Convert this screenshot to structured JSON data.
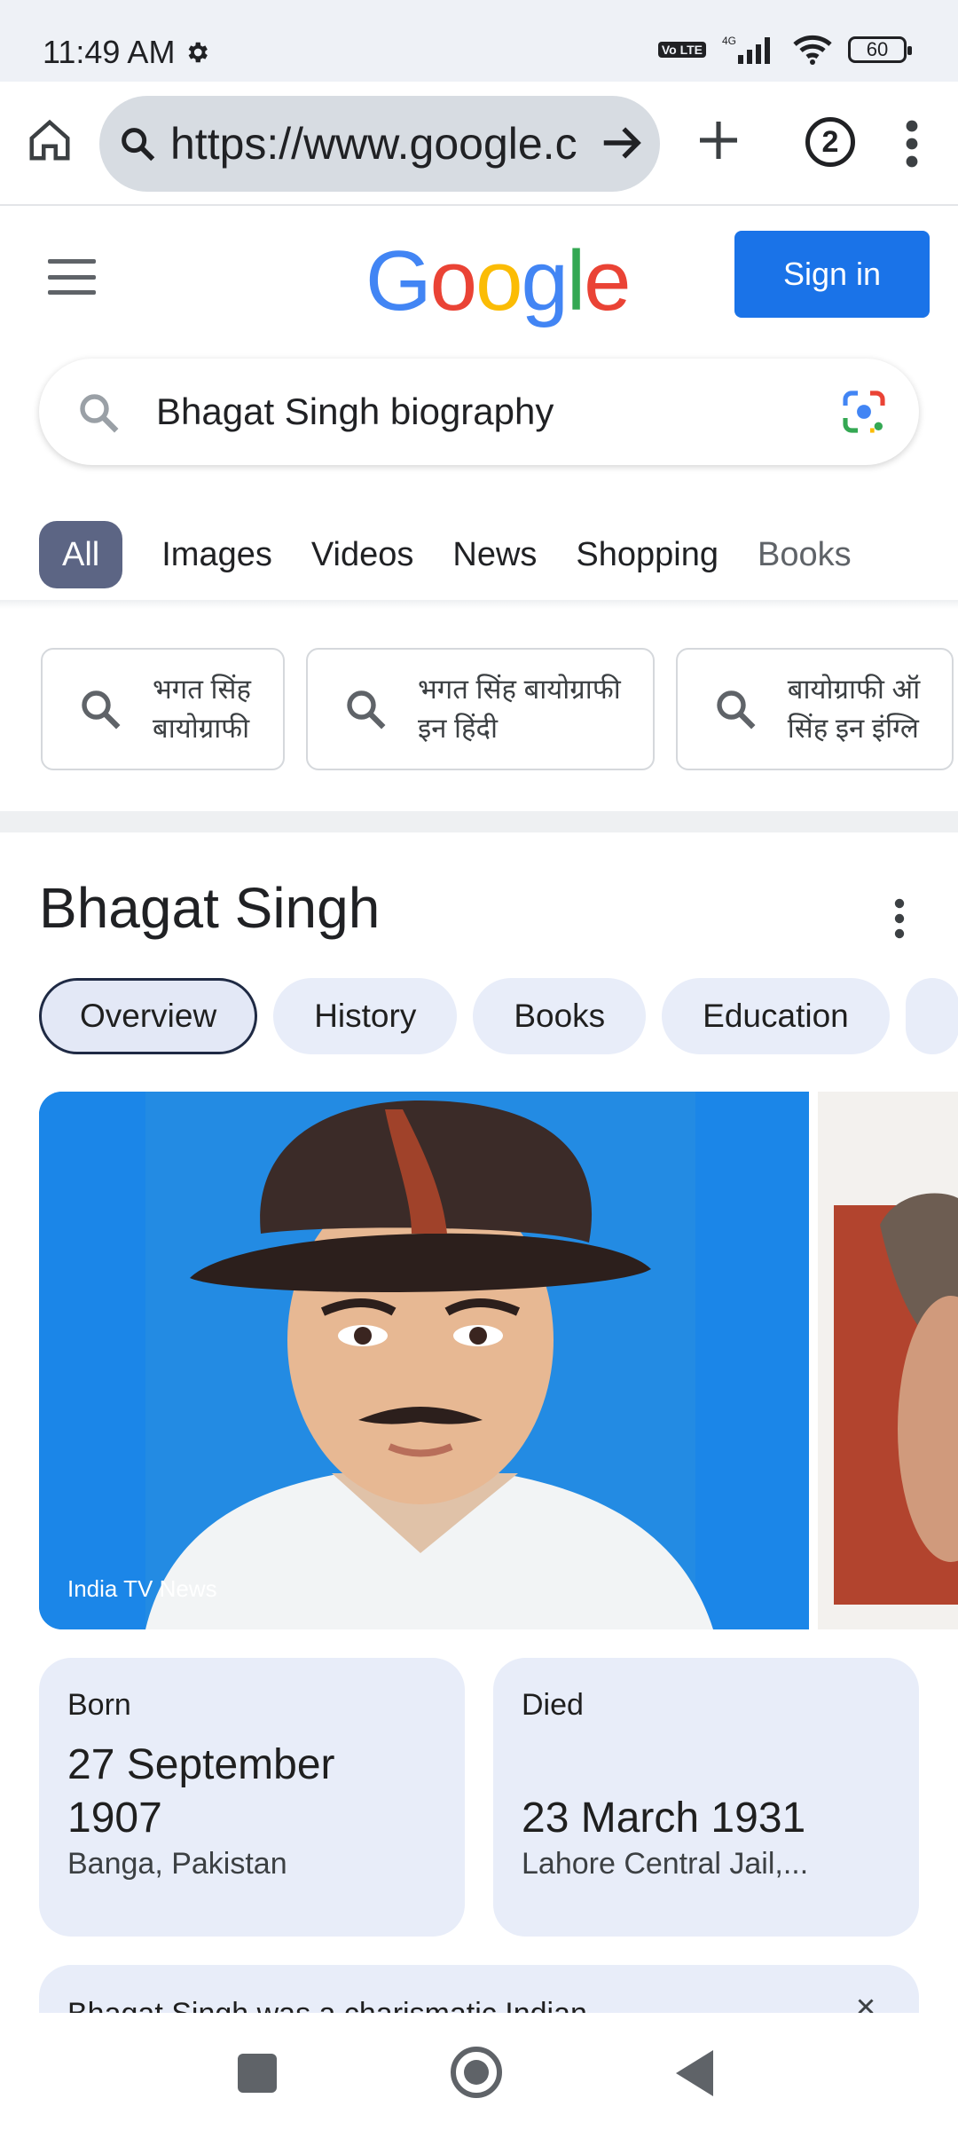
{
  "status_bar": {
    "time": "11:49 AM",
    "network": "4G",
    "volte": "Vo LTE",
    "battery": "60"
  },
  "browser": {
    "url": "https://www.google.c",
    "tab_count": "2"
  },
  "header": {
    "logo": "Google",
    "sign_in": "Sign in"
  },
  "search": {
    "query": "Bhagat Singh biography"
  },
  "tabs": [
    "All",
    "Images",
    "Videos",
    "News",
    "Shopping",
    "Books"
  ],
  "related": [
    {
      "line1": "भगत सिंह",
      "line2": "बायोग्राफी"
    },
    {
      "line1": "भगत सिंह बायोग्राफी",
      "line2": "इन हिंदी"
    },
    {
      "line1": "बायोग्राफी ऑ",
      "line2": "सिंह इन इंग्लि"
    }
  ],
  "knowledge_panel": {
    "title": "Bhagat Singh",
    "tabs": [
      "Overview",
      "History",
      "Books",
      "Education"
    ],
    "image_credit": "India TV News",
    "born": {
      "label": "Born",
      "value": "27 September 1907",
      "place": "Banga, Pakistan"
    },
    "died": {
      "label": "Died",
      "value": "23 March 1931",
      "place": "Lahore Central Jail,..."
    },
    "description": "Bhagat Singh was a charismatic Indian"
  },
  "colors": {
    "accent": "#1a73e8",
    "chip_bg": "#e8edf9",
    "active_tab": "#5c6584",
    "image_bg": "#1b86e8"
  }
}
